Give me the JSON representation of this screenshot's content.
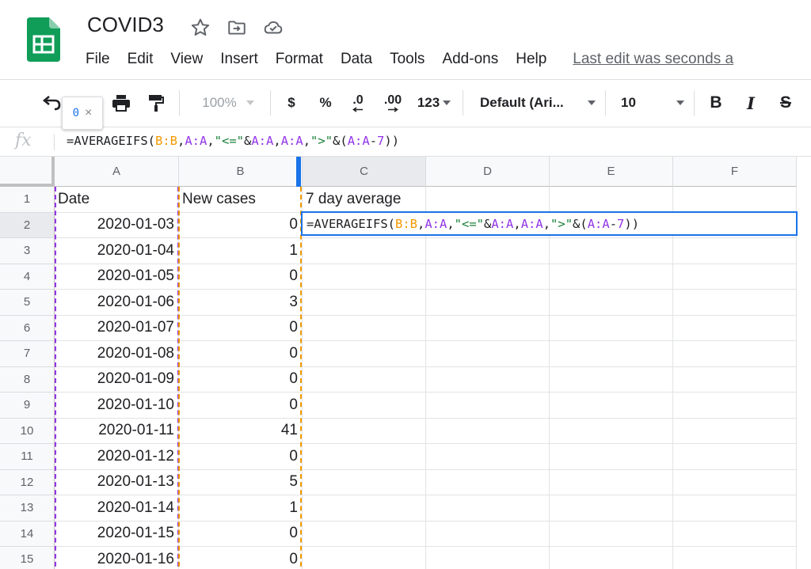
{
  "header": {
    "doc_title": "COVID3",
    "menu": [
      "File",
      "Edit",
      "View",
      "Insert",
      "Format",
      "Data",
      "Tools",
      "Add-ons",
      "Help"
    ],
    "last_edit": "Last edit was seconds a",
    "icons": [
      "sheets-logo-icon",
      "star-icon",
      "move-to-folder-icon",
      "cloud-saved-icon"
    ]
  },
  "toolbar": {
    "zoom": "100%",
    "currency": "$",
    "percent": "%",
    "decrease_decimal": ".0",
    "increase_decimal": ".00",
    "more_formats": "123",
    "font": "Default (Ari...",
    "font_size": "10",
    "bold": "B",
    "italic": "I",
    "strike": "S",
    "tooltip_value": "0",
    "tooltip_close": "×"
  },
  "formula_bar": {
    "fx": "fx",
    "formula_parts": [
      {
        "t": "=AVERAGEIFS(",
        "c": "op"
      },
      {
        "t": "B:B",
        "c": "refB"
      },
      {
        "t": ",",
        "c": "op"
      },
      {
        "t": "A:A",
        "c": "refA"
      },
      {
        "t": ",",
        "c": "op"
      },
      {
        "t": "\"<=\"",
        "c": "str"
      },
      {
        "t": "&",
        "c": "op"
      },
      {
        "t": "A:A",
        "c": "refA"
      },
      {
        "t": ",",
        "c": "op"
      },
      {
        "t": "A:A",
        "c": "refA"
      },
      {
        "t": ",",
        "c": "op"
      },
      {
        "t": "\">\"",
        "c": "str"
      },
      {
        "t": "&(",
        "c": "op"
      },
      {
        "t": "A:A",
        "c": "refA"
      },
      {
        "t": "-",
        "c": "op"
      },
      {
        "t": "7",
        "c": "num"
      },
      {
        "t": "))",
        "c": "op"
      }
    ]
  },
  "grid": {
    "columns": [
      {
        "id": "A",
        "width": 157
      },
      {
        "id": "B",
        "width": 156
      },
      {
        "id": "C",
        "width": 156
      },
      {
        "id": "D",
        "width": 156
      },
      {
        "id": "E",
        "width": 156
      },
      {
        "id": "F",
        "width": 156
      }
    ],
    "header_row": {
      "A": "Date",
      "B": "New cases",
      "C": "7 day average"
    },
    "rows": [
      {
        "n": "2",
        "date": "2020-01-03",
        "cases": "0"
      },
      {
        "n": "3",
        "date": "2020-01-04",
        "cases": "1"
      },
      {
        "n": "4",
        "date": "2020-01-05",
        "cases": "0"
      },
      {
        "n": "5",
        "date": "2020-01-06",
        "cases": "3"
      },
      {
        "n": "6",
        "date": "2020-01-07",
        "cases": "0"
      },
      {
        "n": "7",
        "date": "2020-01-08",
        "cases": "0"
      },
      {
        "n": "8",
        "date": "2020-01-09",
        "cases": "0"
      },
      {
        "n": "9",
        "date": "2020-01-10",
        "cases": "0"
      },
      {
        "n": "10",
        "date": "2020-01-11",
        "cases": "41"
      },
      {
        "n": "11",
        "date": "2020-01-12",
        "cases": "0"
      },
      {
        "n": "12",
        "date": "2020-01-13",
        "cases": "5"
      },
      {
        "n": "13",
        "date": "2020-01-14",
        "cases": "1"
      },
      {
        "n": "14",
        "date": "2020-01-15",
        "cases": "0"
      },
      {
        "n": "15",
        "date": "2020-01-16",
        "cases": "0"
      }
    ],
    "active_cell": "C2"
  },
  "colors": {
    "range_a": "#9334e6",
    "range_b": "#f29900",
    "selection": "#1a73e8",
    "string": "#188038"
  }
}
